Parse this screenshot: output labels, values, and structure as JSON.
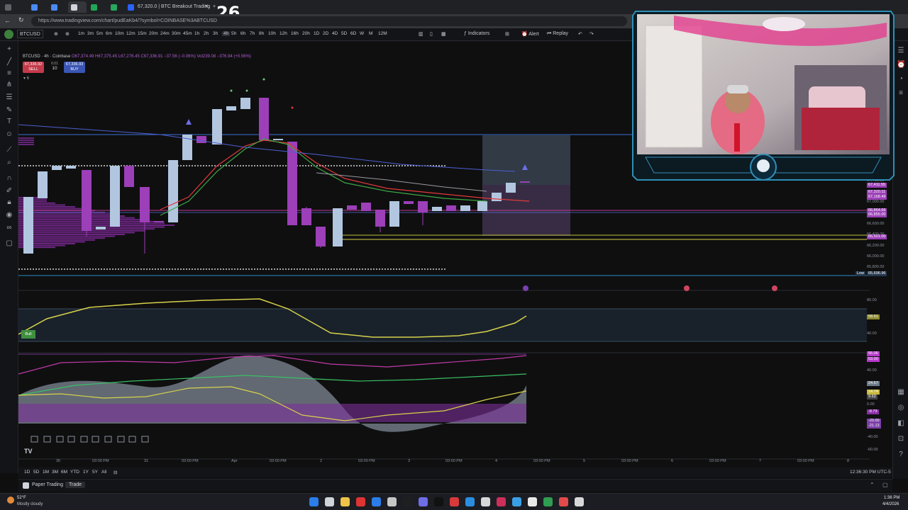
{
  "browser": {
    "tabs": [
      {
        "label": ""
      },
      {
        "label": ""
      },
      {
        "label": ""
      },
      {
        "label": ""
      },
      {
        "label": ""
      },
      {
        "label": ""
      },
      {
        "label": "67,320.0 | BTC Breakout Trading"
      }
    ],
    "url": "https://www.tradingview.com/chart/pudEaKb4/?symbol=COINBASE%3ABTCUSD",
    "overlay_counter": "26"
  },
  "toolbar": {
    "symbol": "BTCUSD",
    "timeframes": [
      "1m",
      "3m",
      "5m",
      "6m",
      "10m",
      "12m",
      "15m",
      "20m",
      "24m",
      "30m",
      "45m",
      "1h",
      "2h",
      "3h",
      "4h",
      "5h",
      "6h",
      "7h",
      "8h",
      "10h",
      "12h",
      "16h",
      "20h",
      "1D",
      "2D",
      "4D",
      "5D",
      "6D",
      "W",
      "M",
      "12M"
    ],
    "selected_timeframe": "4h",
    "indicators_label": "Indicators",
    "alert_label": "Alert",
    "replay_label": "Replay"
  },
  "legend": {
    "title": "BTCUSD · 4h · Coinbase",
    "ohlc": "O67,374.49 H67,375.45 L67,276.45 C67,336.91 −37.56 (−0.06%)",
    "volume": "Vol239.08  −376.94 (+0.56%)",
    "sell_price": "67,336.92",
    "sell_label": "SELL",
    "spread": "0.01",
    "qty": "10",
    "buy_price": "67,336.93",
    "buy_label": "BUY",
    "indicator_count": "6"
  },
  "price_axis": {
    "labels": [
      "67,400.00",
      "67,200.00",
      "67,000.00",
      "66,800.00",
      "66,600.00",
      "66,400.00",
      "66,200.00",
      "66,000.00",
      "65,800.00"
    ],
    "tags": [
      {
        "text": "67,411.55",
        "color": "#9c3fb8"
      },
      {
        "text": "67,320.11",
        "color": "#9c3fb8"
      },
      {
        "text": "67,168.49",
        "color": "#9c3fb8"
      },
      {
        "text": "66,864.66",
        "color": "#9c3fb8"
      },
      {
        "text": "66,855.00",
        "color": "#9c3fb8"
      },
      {
        "text": "66,501.00",
        "color": "#9c3fb8"
      },
      {
        "text": "65,696.96",
        "color": "#24384d"
      }
    ],
    "low_label": "Low"
  },
  "rsi_panel": {
    "labels": [
      "80.00",
      "58.91",
      "40.00"
    ],
    "bull_label": "Bull"
  },
  "osc_panel": {
    "labels": [
      "55.06",
      "53.00",
      "40.00",
      "24.57",
      "14.74",
      "9.63",
      "0.00",
      "-8.79",
      "-20.00",
      "-21.13",
      "-40.00",
      "-60.00"
    ]
  },
  "time_axis": {
    "labels": [
      "30",
      "03:00 PM",
      "31",
      "03:00 PM",
      "Apr",
      "03:00 PM",
      "2",
      "03:00 PM",
      "3",
      "03:00 PM",
      "4",
      "03:00 PM",
      "5",
      "03:00 PM",
      "6",
      "03:00 PM",
      "7",
      "03:00 PM",
      "8"
    ]
  },
  "bottom": {
    "ranges": [
      "1D",
      "5D",
      "1M",
      "3M",
      "6M",
      "YTD",
      "1Y",
      "5Y",
      "All"
    ],
    "clock": "12:36:30 PM UTC-5",
    "paper_trading": "Paper Trading",
    "trade": "Trade"
  },
  "taskbar": {
    "weather_temp": "52°F",
    "weather_desc": "Mostly cloudy",
    "time": "1:36 PM",
    "date": "4/4/2026"
  },
  "colors": {
    "bull_candle": "#b2c6e0",
    "bear_candle": "#9c3fb8",
    "accent": "#2962ff"
  }
}
